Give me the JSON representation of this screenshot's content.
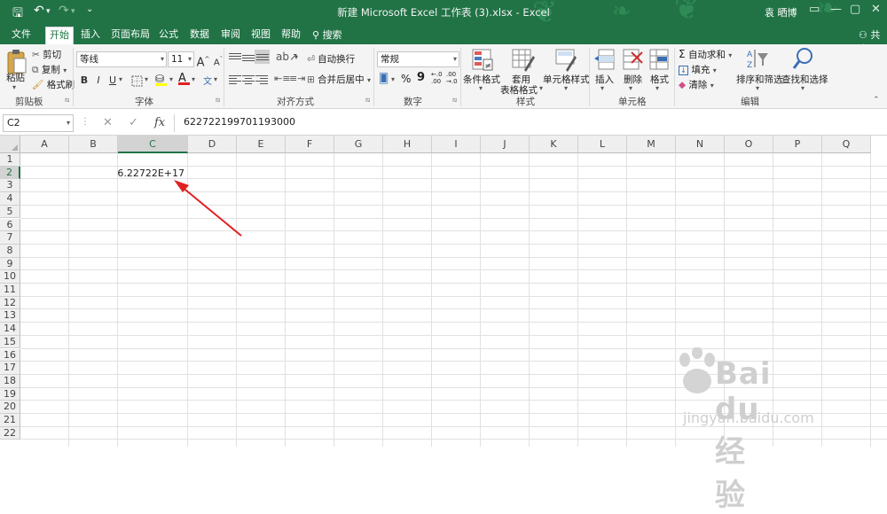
{
  "window": {
    "title": "新建 Microsoft Excel 工作表 (3).xlsx - Excel",
    "user": "袁 晒博",
    "quick_access": {
      "save": "🖫",
      "undo": "↶",
      "redo": "↷",
      "customize": "⌄"
    }
  },
  "tabs": [
    {
      "label": "文件"
    },
    {
      "label": "开始"
    },
    {
      "label": "插入"
    },
    {
      "label": "页面布局"
    },
    {
      "label": "公式"
    },
    {
      "label": "数据"
    },
    {
      "label": "审阅"
    },
    {
      "label": "视图"
    },
    {
      "label": "帮助"
    }
  ],
  "active_tab": "开始",
  "tell_me": "搜索",
  "share": "共享",
  "ribbon": {
    "clipboard": {
      "paste": "粘贴",
      "cut": "剪切",
      "copy": "复制",
      "format_painter": "格式刷",
      "label": "剪贴板"
    },
    "font": {
      "font_name": "等线",
      "font_size": "11",
      "grow": "A",
      "shrink": "A",
      "bold": "B",
      "italic": "I",
      "underline": "U",
      "font_color": "A",
      "phonetic": "文",
      "label": "字体"
    },
    "alignment": {
      "wrap_text": "自动换行",
      "merge_center": "合并后居中",
      "label": "对齐方式"
    },
    "number": {
      "format": "常规",
      "percent": "%",
      "comma": "9",
      "label": "数字"
    },
    "styles": {
      "conditional": "条件格式",
      "table_line1": "套用",
      "table_line2": "表格格式",
      "cell_styles": "单元格样式",
      "label": "样式"
    },
    "cells": {
      "insert": "插入",
      "delete": "删除",
      "format": "格式",
      "label": "单元格"
    },
    "editing": {
      "autosum": "自动求和",
      "fill": "填充",
      "clear": "清除",
      "sort_filter": "排序和筛选",
      "find_select": "查找和选择",
      "label": "编辑"
    }
  },
  "formula_bar": {
    "name_box": "C2",
    "cancel": "✕",
    "enter": "✓",
    "fx": "fx",
    "value": "622722199701193000"
  },
  "columns": [
    "A",
    "B",
    "C",
    "D",
    "E",
    "F",
    "G",
    "H",
    "I",
    "J",
    "K",
    "L",
    "M",
    "N",
    "O",
    "P",
    "Q"
  ],
  "rows": [
    "1",
    "2",
    "3",
    "4",
    "5",
    "6",
    "7",
    "8",
    "9",
    "10",
    "11",
    "12",
    "13",
    "14",
    "15",
    "16",
    "17",
    "18",
    "19",
    "20",
    "21",
    "22"
  ],
  "selected_cell": "C2",
  "cells": {
    "C2": "6.22722E+17"
  },
  "annotation_color": "#e02020",
  "accent_color": "#217346",
  "watermark": {
    "logo_text": "Bai du 经验",
    "url": "jingyan.baidu.com"
  }
}
